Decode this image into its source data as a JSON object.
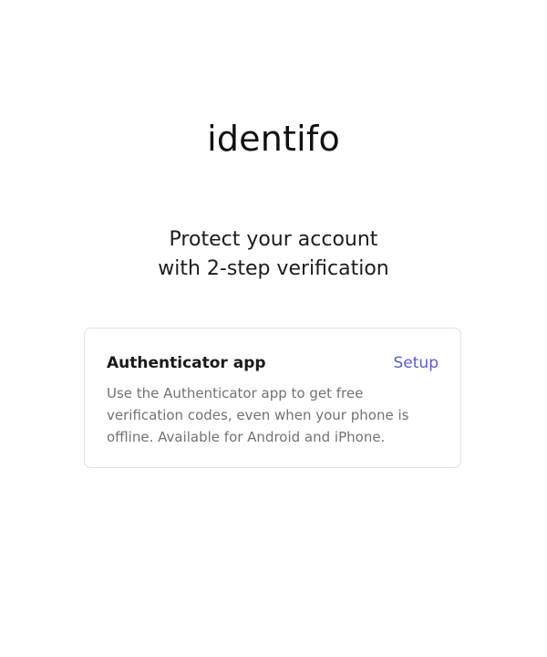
{
  "app": {
    "logo_text": "identifo"
  },
  "headline": {
    "line1": "Protect your account",
    "line2": "with 2-step verification"
  },
  "methods": [
    {
      "title": "Authenticator app",
      "action_label": "Setup",
      "description": "Use the Authenticator app to get free verification codes, even when your phone is offline. Available for Android and iPhone."
    }
  ],
  "colors": {
    "link": "#5a5cd6",
    "muted_text": "#727277",
    "border": "#e0e0e4"
  }
}
